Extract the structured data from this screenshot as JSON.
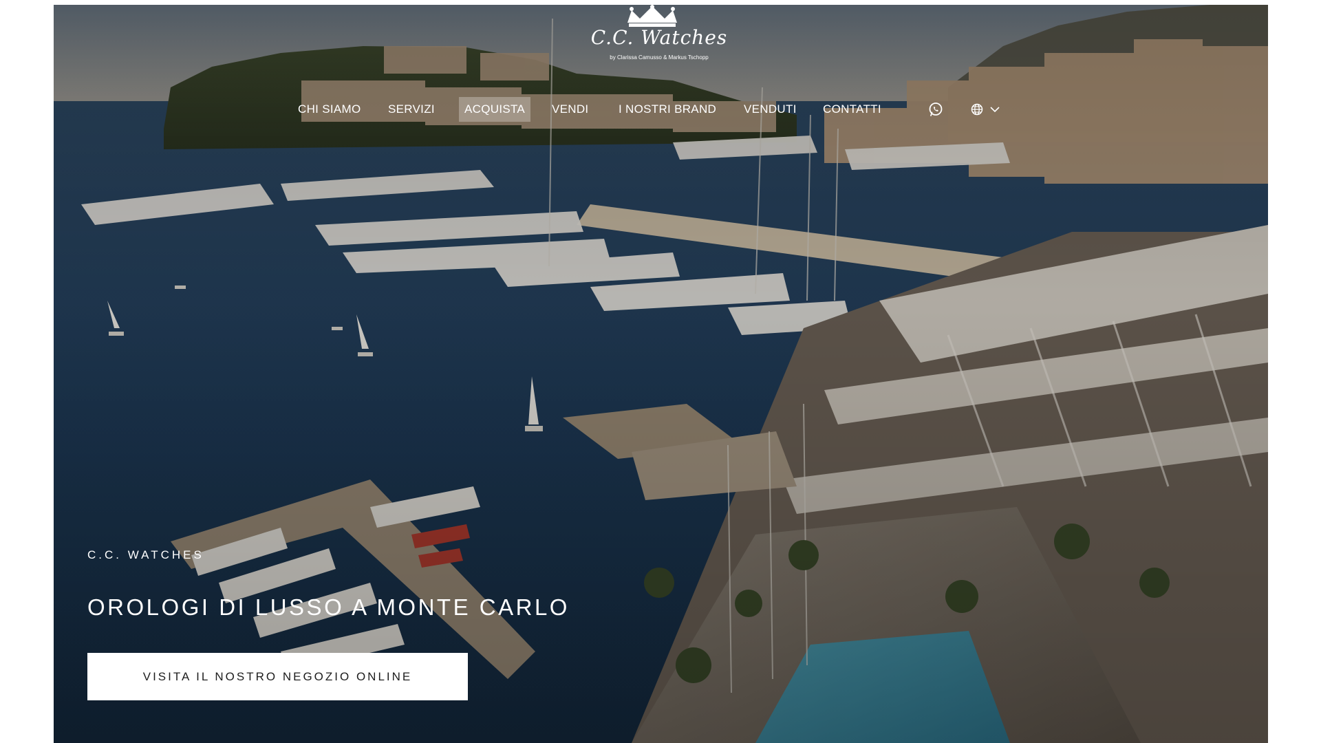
{
  "brand": {
    "wordmark": "C.C. Watches",
    "tagline": "by Clarissa Camusso & Markus Tschopp",
    "logo_icon": "crown-icon"
  },
  "nav": {
    "items": [
      {
        "label": "CHI SIAMO",
        "active": false
      },
      {
        "label": "SERVIZI",
        "active": false
      },
      {
        "label": "ACQUISTA",
        "active": true
      },
      {
        "label": "VENDI",
        "active": false
      },
      {
        "label": "I NOSTRI BRAND",
        "active": false
      },
      {
        "label": "VENDUTI",
        "active": false
      },
      {
        "label": "CONTATTI",
        "active": false
      }
    ],
    "whatsapp_icon": "whatsapp-icon",
    "language_icon": "globe-icon",
    "language_dropdown_icon": "chevron-down-icon"
  },
  "hero": {
    "eyebrow": "C.C. WATCHES",
    "headline": "OROLOGI DI LUSSO A MONTE CARLO",
    "cta_label": "VISITA IL NOSTRO NEGOZIO ONLINE",
    "background": "monte-carlo-harbor-photo"
  },
  "colors": {
    "text": "#ffffff",
    "cta_background": "#ffffff",
    "cta_text": "#1c1c1c",
    "sea": "#1d3a55"
  }
}
